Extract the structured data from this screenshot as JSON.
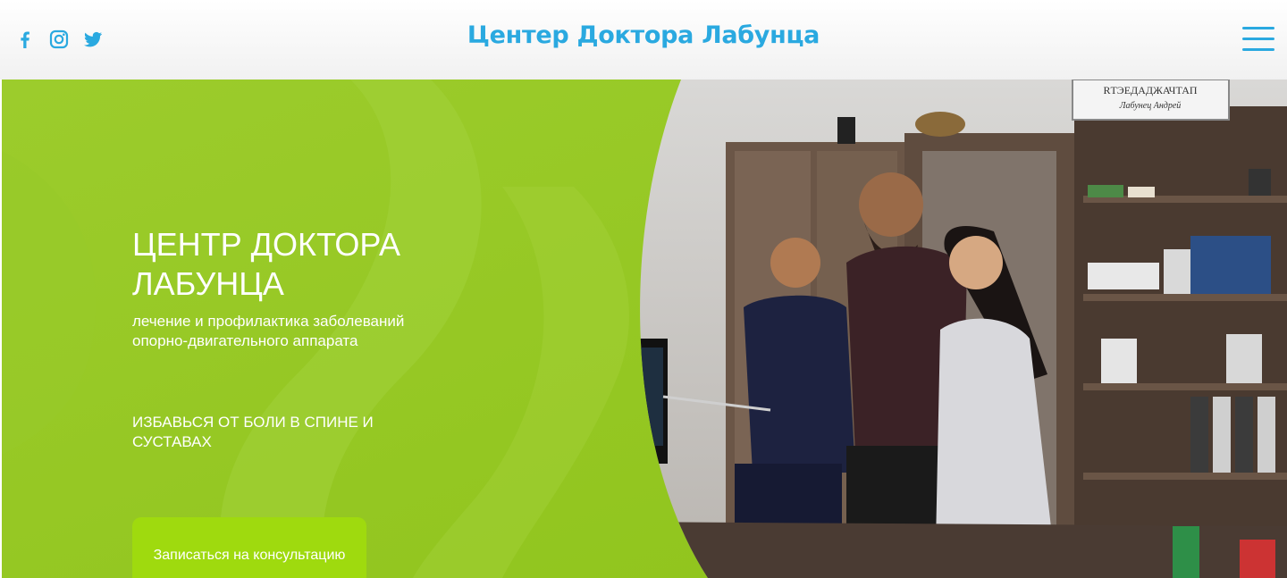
{
  "header": {
    "brand": "Центер Доктора Лабунца",
    "social": [
      {
        "icon": "facebook-icon"
      },
      {
        "icon": "instagram-icon"
      },
      {
        "icon": "twitter-icon"
      }
    ],
    "menu_icon": "hamburger-menu-icon"
  },
  "hero": {
    "title": "ЦЕНТР ДОКТОРА ЛАБУНЦА",
    "subtitle": "лечение и профилактика заболеваний опорно-двигательного аппарата",
    "tagline": "ИЗБАВЬСЯ ОТ БОЛИ В СПИНЕ И СУСТАВАХ",
    "cta_label": "Записаться на консультацию",
    "photo_sign_line1": "RТЭЕДАДЖАЧТАП",
    "photo_sign_line2": "Лабунец Андрей"
  },
  "colors": {
    "accent": "#2aa9e0",
    "green_panel": "#8fbf24",
    "button": "#9fda0e"
  }
}
